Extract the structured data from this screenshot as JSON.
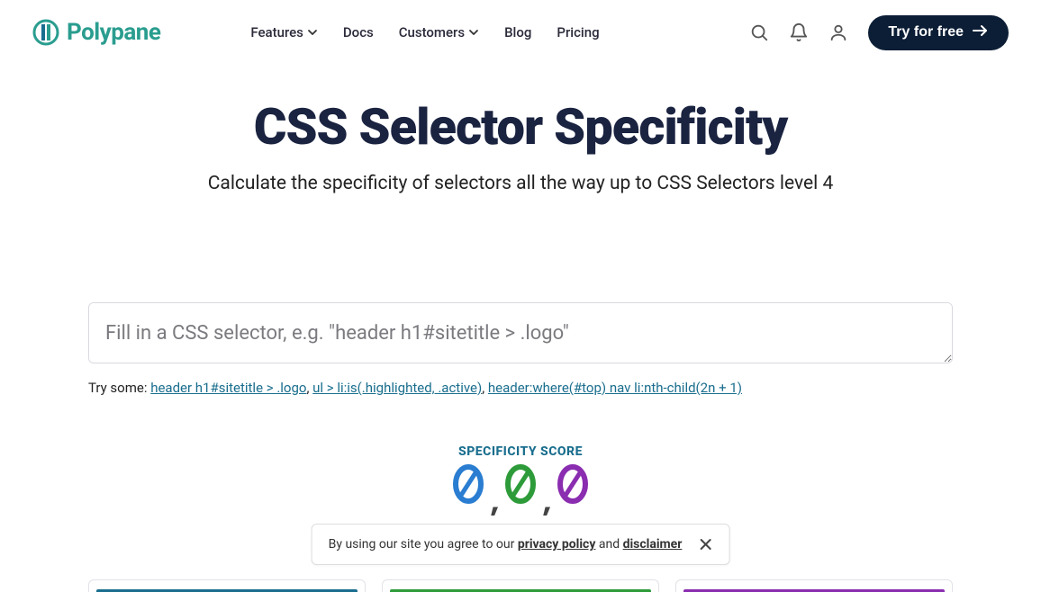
{
  "brand": "Polypane",
  "nav": {
    "features": "Features",
    "docs": "Docs",
    "customers": "Customers",
    "blog": "Blog",
    "pricing": "Pricing"
  },
  "cta": "Try for free",
  "hero": {
    "title": "CSS Selector Specificity",
    "subtitle": "Calculate the specificity of selectors all the way up to CSS Selectors level 4"
  },
  "input": {
    "placeholder": "Fill in a CSS selector, e.g. \"header h1#sitetitle > .logo\""
  },
  "try": {
    "label": "Try some: ",
    "ex1": "header h1#sitetitle > .logo",
    "ex2": "ul > li:is(.highlighted, .active)",
    "ex3": "header:where(#top) nav li:nth-child(2n + 1)"
  },
  "score": {
    "label": "SPECIFICITY SCORE",
    "a": "0",
    "b": "0",
    "c": "0",
    "colors": {
      "a": "#2a7dd1",
      "b": "#2e9b3a",
      "c": "#8a2db0"
    }
  },
  "cookie": {
    "prefix": "By using our site you agree to our ",
    "privacy": "privacy policy",
    "and": " and ",
    "disclaimer": "disclaimer"
  }
}
